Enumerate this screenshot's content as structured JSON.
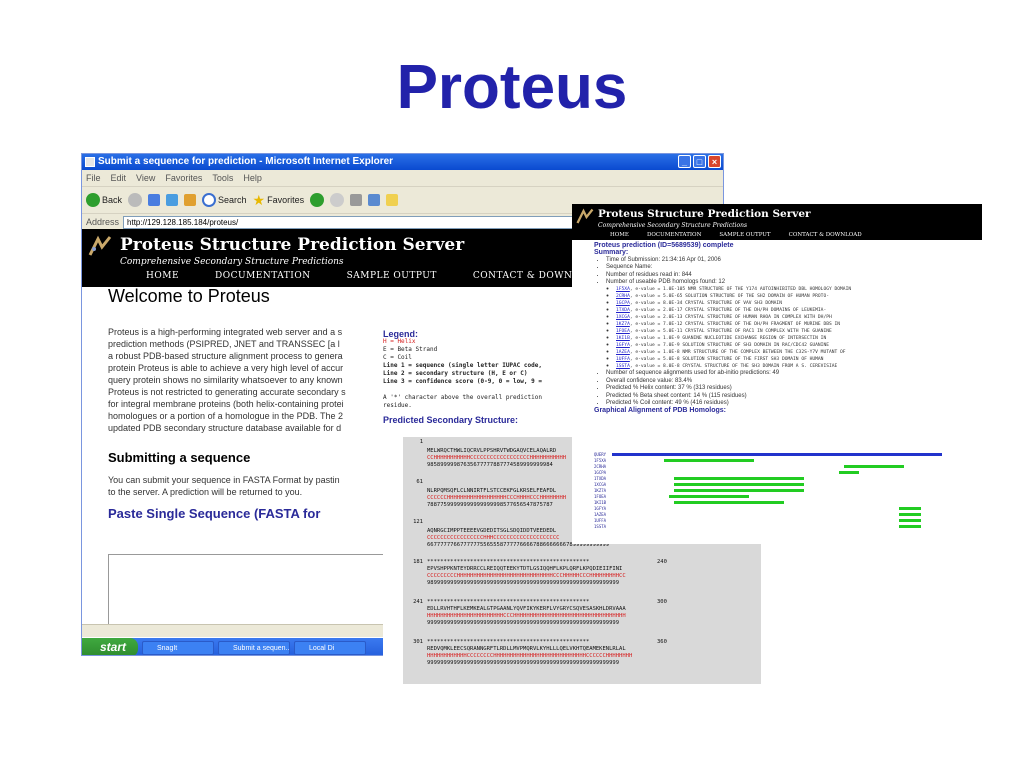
{
  "slide": {
    "title": "Proteus"
  },
  "ie": {
    "window_title": "Submit a sequence for prediction - Microsoft Internet Explorer",
    "menu": [
      "File",
      "Edit",
      "View",
      "Favorites",
      "Tools",
      "Help"
    ],
    "toolbar": {
      "back": "Back",
      "search": "Search",
      "favorites": "Favorites"
    },
    "address_label": "Address",
    "address_value": "http://129.128.185.184/proteus/",
    "go_label": "Go"
  },
  "site": {
    "title": "Proteus Structure Prediction Server",
    "subtitle": "Comprehensive Secondary Structure Predictions",
    "nav": [
      "HOME",
      "DOCUMENTATION",
      "SAMPLE OUTPUT",
      "CONTACT & DOWNLOAD"
    ]
  },
  "page": {
    "heading": "Welcome to Proteus",
    "intro_lines": [
      "Proteus is a high-performing integrated web server and a s",
      "prediction methods (PSIPRED, JNET and TRANSSEC [a l",
      "a robust PDB-based structure alignment process to genera",
      "protein Proteus is able to achieve a very high level of accur",
      "query protein shows no similarity whatsoever to any known",
      "Proteus is not restricted to generating accurate secondary s",
      "for integral membrane proteins (both helix-containing protei",
      "homologues or a portion of a homologue in the PDB. The 2",
      "updated PDB secondary structure database available for d"
    ],
    "submit_heading": "Submitting a sequence",
    "submit_lines": [
      "You can submit your sequence in FASTA Format by pastin",
      "to the server.  A prediction will be returned to you."
    ],
    "paste_heading": "Paste Single Sequence (FASTA for"
  },
  "taskbar": {
    "start": "start",
    "tasks": [
      "SnagIt",
      "Submit a sequen...",
      "Local Di"
    ]
  },
  "legend": {
    "title": "Legend:",
    "lines": [
      "H = Helix",
      "E = Beta Strand",
      "C = Coil",
      "Line 1 = sequence (single letter IUPAC code,",
      "Line 2 = secondary structure (H, E or C)",
      "Line 3 = confidence score (0-9, 0 = low, 9 =",
      "",
      "A '*' character above the overall prediction",
      "residue."
    ],
    "ss_title": "Predicted Secondary Structure:"
  },
  "sequence_blocks": [
    {
      "start": "1",
      "end": "",
      "stars": "",
      "seq": "MELWRQCTHWLIQCRVLPPSHRVTWDGAQVCELAQALRD",
      "ss": "CCHHHHHHHHHHHCCCCCCCCCCCCCCCCCCHHHHHHHHHHH",
      "conf": "98589999987635677777887774589999999984"
    },
    {
      "start": "61",
      "end": "",
      "stars": "",
      "seq": "NLRPQMSQFLCLNNIRTFLSTCCEKFGLKRSELFEAFDL",
      "ss": "CCCCCCHHHHHHHHHHHHHHHHHHCCCHHHHCCCHHHHHHHH",
      "conf": "78877599999999999999998577656547875787"
    },
    {
      "start": "121",
      "end": "",
      "stars": "",
      "seq": "AQNRGCIMPPTEEEEVGDEDITSGLSDQIDDTVEEDEDL",
      "ss": "CCCCCCCCCCCCCCCCCHHHCCCCCCCCCCCCCCCCCCCC",
      "conf": "6677777766777777556555877777666678866666667899999999999"
    },
    {
      "start": "181",
      "end": "240",
      "stars": "*************************************************",
      "seq": "EPVSHPPKNTEYDRRCCLREIQQTEEKYTDTLGSIQQHFLKPLQRFLKPQDIEIIFINI",
      "ss": "CCCCCCCCCHHHHHHHHHHHHHHHHHHHHHHHHHHHHHCCCHHHHHCCCHHHHHHHHHCC",
      "conf": "9899999999999999999999999999999999999999999999999999999999"
    },
    {
      "start": "241",
      "end": "300",
      "stars": "*************************************************",
      "seq": "EDLLRVHTHFLKEMKEALGTPGAANLYQVFIKYKERFLVYGRYCSQVESASKHLDRVAAA",
      "ss": "HHHHHHHHHHHHHHHHHHHHHHHCCCHHHHHHHHHHHHHHHHHHHHHHHHHHHHHHHHHH",
      "conf": "9999999999999999999999999999999999999999999999999999999999"
    },
    {
      "start": "301",
      "end": "360",
      "stars": "*************************************************",
      "seq": "REDVQMKLEECSQRANNGRFTLRDLLMVPMQRVLKYHLLLQELVKHTQEAMEKENLRLAL",
      "ss": "HHHHHHHHHHHHCCCCCCCCHHHHHHHHHHHHHHHHHHHHHHHHHHHHCCCCCCHHHHHHHH",
      "conf": "9999999999999999999999999999999999999999999999999999999999"
    }
  ],
  "results": {
    "title": "Proteus Structure Prediction Server",
    "subtitle": "Comprehensive Secondary Structure Predictions",
    "nav": [
      "HOME",
      "DOCUMENTATION",
      "SAMPLE OUTPUT",
      "CONTACT & DOWNLOAD"
    ],
    "complete": "Proteus prediction (ID=5689539) complete",
    "summary_label": "Summary:",
    "summary_items": [
      "Time of Submission: 21:34:16 Apr 01, 2006",
      "Sequence Name:",
      "Number of residues read in: 844",
      "Number of useable PDB homologs found: 12"
    ],
    "homologs": [
      {
        "id": "1F5XA",
        "text": ", e-value = 1.0E-105 NMR STRUCTURE OF THE Y174 AUTOINHIBITED DBL HOMOLOGY DOMAIN"
      },
      {
        "id": "2CRHA",
        "text": ", e-value = 5.0E-65 SOLUTION STRUCTURE OF THE SH2 DOMAIN OF HUMAN PROTO-"
      },
      {
        "id": "1GCPA",
        "text": ", e-value = 8.0E-34 CRYSTAL STRUCTURE OF VAV SH3 DOMAIN"
      },
      {
        "id": "1TXDA",
        "text": ", e-value = 2.0E-17 CRYSTAL STRUCTURE OF THE DH/PH DOMAINS OF LEUKEMIA-"
      },
      {
        "id": "1XCGA",
        "text": ", e-value = 2.0E-13 CRYSTAL STRUCTURE OF HUMAN RHOA IN COMPLEX WITH DH/PH"
      },
      {
        "id": "1KZ7A",
        "text": ", e-value = 7.0E-12 CRYSTAL STRUCTURE OF THE DH/PH FRAGMENT OF MURINE DBS IN"
      },
      {
        "id": "1FOEA",
        "text": ", e-value = 5.0E-11 CRYSTAL STRUCTURE OF RAC1 IN COMPLEX WITH THE GUANINE"
      },
      {
        "id": "1KI1B",
        "text": ", e-value = 1.0E-9 GUANINE NUCLEOTIDE EXCHANGE REGION OF INTERSECTIN IN"
      },
      {
        "id": "1GFYA",
        "text": ", e-value = 7.0E-9 SOLUTION STRUCTURE OF SH3 DOMAIN IN RAC/CDC42 GUANINE"
      },
      {
        "id": "1AZEA",
        "text": ", e-value = 1.0E-8 NMR STRUCTURE OF THE COMPLEX BETWEEN THE C32S-Y7V MUTANT OF"
      },
      {
        "id": "1UFFA",
        "text": ", e-value = 5.0E-8 SOLUTION STRUCTURE OF THE FIRST SH3 DOMAIN OF HUMAN"
      },
      {
        "id": "1SSTA",
        "text": ", e-value = 8.0E-8 CRYSTAL STRUCTURE OF THE SH3 DOMAIN FROM A S. CEREVISIAE"
      }
    ],
    "post_items": [
      "Number of sequence alignments used for ab-initio predictions: 49",
      "Overall confidence value: 83.4%",
      "Predicted % Helix content: 37 % (313 residues)",
      "Predicted % Beta sheet content: 14 % (115 residues)",
      "Predicted % Coil content: 49 % (416 residues)"
    ],
    "graph_label": "Graphical Alignment of PDB Homologs:",
    "align_labels": [
      "QUERY",
      "1F5XA",
      "2CRHA",
      "1GCPA",
      "1TXDA",
      "1XCGA",
      "1KZ7A",
      "1FOEA",
      "1KI1B",
      "1GFYA",
      "1AZEA",
      "1UFFA",
      "1SSTA"
    ]
  }
}
